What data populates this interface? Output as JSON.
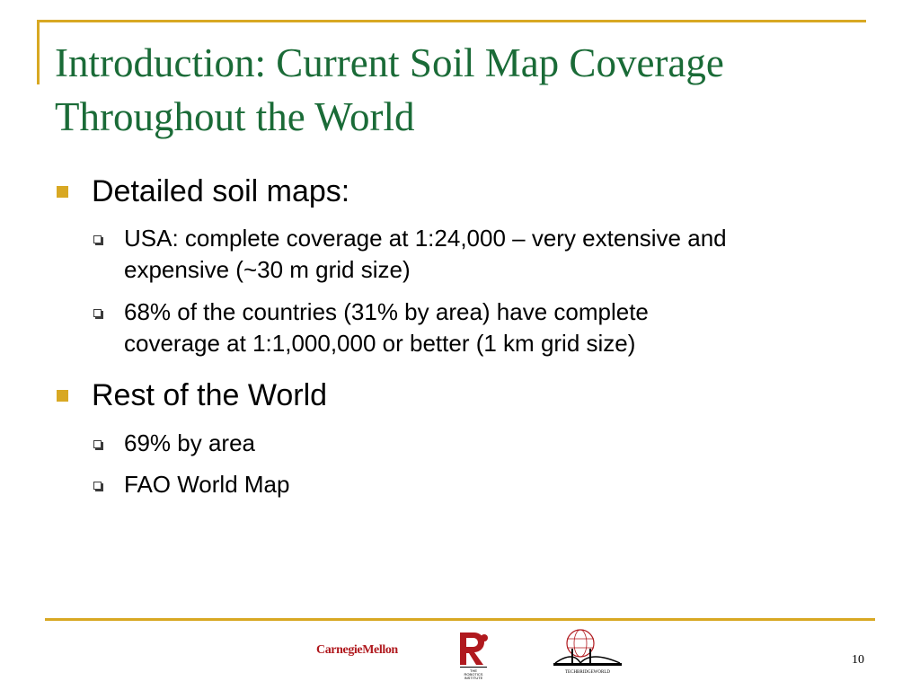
{
  "slide": {
    "title_line1": "Introduction: Current Soil Map Coverage",
    "title_line2": "Throughout the World",
    "bullets": [
      {
        "text": "Detailed soil maps:",
        "sub": [
          {
            "line1": "USA: complete coverage at 1:24,000 – very extensive and",
            "line2": "expensive (~30 m grid size)"
          },
          {
            "line1": "68% of the countries (31% by area) have complete",
            "line2": "coverage at 1:1,000,000 or better (1 km grid size)"
          }
        ]
      },
      {
        "text": "Rest of the World",
        "sub": [
          {
            "line1": "69% by area"
          },
          {
            "line1": "FAO World Map"
          }
        ]
      }
    ],
    "page_number": "10"
  },
  "footer": {
    "logos": {
      "carnegie_mellon": "CarnegieMellon",
      "robotics_institute": "THE ROBOTICS INSTITUTE",
      "techbridgeworld": "TECHBRIDGEWORLD"
    }
  },
  "colors": {
    "title": "#1a6b37",
    "accent": "#d8a823",
    "cmu_red": "#b0191e"
  }
}
